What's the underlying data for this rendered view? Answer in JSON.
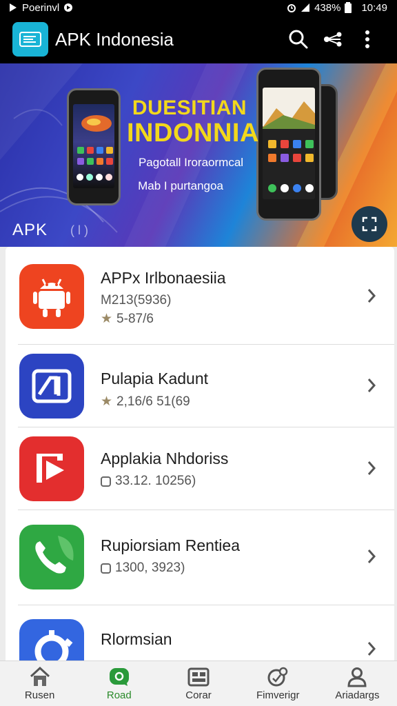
{
  "status_bar": {
    "carrier": "Poerinvl",
    "battery": "438%",
    "time": "10:49"
  },
  "app_bar": {
    "title": "APK Indonesia",
    "icons": [
      "app-logo",
      "search-icon",
      "share-icon",
      "more-vert-icon"
    ]
  },
  "banner": {
    "headline_1": "DUESITIAN",
    "headline_2": "INDONNIA",
    "subtitle_1": "Pagotall Iroraormcal",
    "subtitle_2": "Mab I purtangoa",
    "watermark": "APK",
    "watermark_2": "( l )",
    "colors": {
      "headline": "#f2d81c",
      "fab": "#1e3a4e"
    }
  },
  "apps": [
    {
      "name": "APPx Irlbonaesiia",
      "meta_1": "M213(5936)",
      "meta_2": "5-87/6",
      "meta_icon": "star-icon",
      "icon": "android-icon",
      "color": "#ee4420"
    },
    {
      "name": "Pulapia Kadunt",
      "meta_1": "2,16/6 51(69",
      "meta_icon": "star-icon",
      "icon": "photo-frame-icon",
      "color": "#2c44c2"
    },
    {
      "name": "Applakia Nhdoriss",
      "meta_1": "33.12. 10256)",
      "meta_icon": "clock-icon",
      "icon": "video-play-icon",
      "color": "#e32e2e"
    },
    {
      "name": "Rupiorsiam Rentiea",
      "meta_1": "1300, 3923)",
      "meta_icon": "clock-icon",
      "icon": "phone-icon",
      "color": "#2fa843"
    },
    {
      "name": "Rlormsian",
      "meta_1": "",
      "meta_icon": "",
      "icon": "settings-ring-icon",
      "color": "#3366e0"
    }
  ],
  "bottom_nav": {
    "items": [
      {
        "label": "Rusen",
        "icon": "home-icon"
      },
      {
        "label": "Road",
        "icon": "bubble-icon",
        "active": true
      },
      {
        "label": "Corar",
        "icon": "grid-card-icon"
      },
      {
        "label": "Fimverigr",
        "icon": "target-icon"
      },
      {
        "label": "Ariadargs",
        "icon": "profile-icon"
      }
    ],
    "active_color": "#2a8a2a"
  }
}
